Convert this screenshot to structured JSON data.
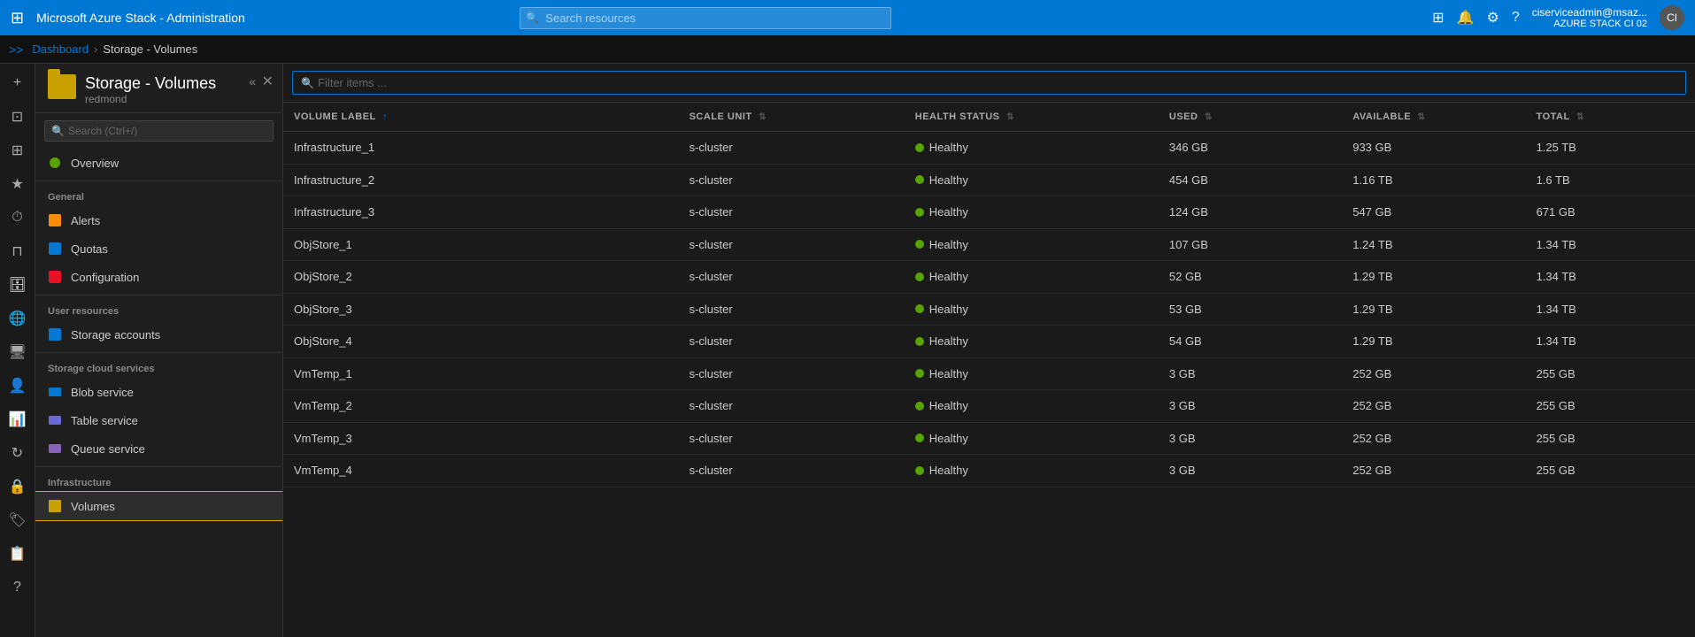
{
  "app": {
    "title": "Microsoft Azure Stack - Administration"
  },
  "topbar": {
    "title": "Microsoft Azure Stack - Administration",
    "search_placeholder": "Search resources",
    "user_name": "ciserviceadmin@msaz...",
    "user_subtitle": "AZURE STACK CI 02",
    "user_initials": "CI"
  },
  "breadcrumb": {
    "expand_label": ">>",
    "items": [
      "Dashboard",
      "Storage - Volumes"
    ]
  },
  "panel": {
    "title": "Storage - Volumes",
    "subtitle": "redmond",
    "icon": "📁",
    "search_placeholder": "Search (Ctrl+/)"
  },
  "nav": {
    "overview_label": "Overview",
    "general_label": "General",
    "general_items": [
      {
        "label": "Alerts",
        "icon": "alerts"
      },
      {
        "label": "Quotas",
        "icon": "quotas"
      },
      {
        "label": "Configuration",
        "icon": "config"
      }
    ],
    "user_resources_label": "User resources",
    "user_items": [
      {
        "label": "Storage accounts",
        "icon": "storage"
      }
    ],
    "storage_cloud_label": "Storage cloud services",
    "cloud_items": [
      {
        "label": "Blob service",
        "icon": "blob"
      },
      {
        "label": "Table service",
        "icon": "table"
      },
      {
        "label": "Queue service",
        "icon": "queue"
      }
    ],
    "infrastructure_label": "Infrastructure",
    "infra_items": [
      {
        "label": "Volumes",
        "icon": "volume",
        "active": true
      }
    ]
  },
  "filter": {
    "placeholder": "Filter items ..."
  },
  "table": {
    "columns": [
      {
        "label": "VOLUME LABEL",
        "key": "volume_label",
        "sortable": true,
        "sorted": true
      },
      {
        "label": "SCALE UNIT",
        "key": "scale_unit",
        "sortable": true
      },
      {
        "label": "HEALTH STATUS",
        "key": "health_status",
        "sortable": true
      },
      {
        "label": "USED",
        "key": "used",
        "sortable": true
      },
      {
        "label": "AVAILABLE",
        "key": "available",
        "sortable": true
      },
      {
        "label": "TOTAL",
        "key": "total",
        "sortable": true
      }
    ],
    "rows": [
      {
        "volume_label": "Infrastructure_1",
        "scale_unit": "s-cluster",
        "health_status": "Healthy",
        "used": "346 GB",
        "available": "933 GB",
        "total": "1.25 TB"
      },
      {
        "volume_label": "Infrastructure_2",
        "scale_unit": "s-cluster",
        "health_status": "Healthy",
        "used": "454 GB",
        "available": "1.16 TB",
        "total": "1.6 TB"
      },
      {
        "volume_label": "Infrastructure_3",
        "scale_unit": "s-cluster",
        "health_status": "Healthy",
        "used": "124 GB",
        "available": "547 GB",
        "total": "671 GB"
      },
      {
        "volume_label": "ObjStore_1",
        "scale_unit": "s-cluster",
        "health_status": "Healthy",
        "used": "107 GB",
        "available": "1.24 TB",
        "total": "1.34 TB"
      },
      {
        "volume_label": "ObjStore_2",
        "scale_unit": "s-cluster",
        "health_status": "Healthy",
        "used": "52 GB",
        "available": "1.29 TB",
        "total": "1.34 TB"
      },
      {
        "volume_label": "ObjStore_3",
        "scale_unit": "s-cluster",
        "health_status": "Healthy",
        "used": "53 GB",
        "available": "1.29 TB",
        "total": "1.34 TB"
      },
      {
        "volume_label": "ObjStore_4",
        "scale_unit": "s-cluster",
        "health_status": "Healthy",
        "used": "54 GB",
        "available": "1.29 TB",
        "total": "1.34 TB"
      },
      {
        "volume_label": "VmTemp_1",
        "scale_unit": "s-cluster",
        "health_status": "Healthy",
        "used": "3 GB",
        "available": "252 GB",
        "total": "255 GB"
      },
      {
        "volume_label": "VmTemp_2",
        "scale_unit": "s-cluster",
        "health_status": "Healthy",
        "used": "3 GB",
        "available": "252 GB",
        "total": "255 GB"
      },
      {
        "volume_label": "VmTemp_3",
        "scale_unit": "s-cluster",
        "health_status": "Healthy",
        "used": "3 GB",
        "available": "252 GB",
        "total": "255 GB"
      },
      {
        "volume_label": "VmTemp_4",
        "scale_unit": "s-cluster",
        "health_status": "Healthy",
        "used": "3 GB",
        "available": "252 GB",
        "total": "255 GB"
      }
    ]
  },
  "icons": {
    "portal": "⊞",
    "bell": "🔔",
    "gear": "⚙",
    "question": "?",
    "search": "🔍",
    "plus": "+",
    "dashboard": "⊡",
    "favorites": "★",
    "allservices": "⊞",
    "recent": "⏱",
    "resource_groups": "⊓",
    "users": "👤",
    "help": "?",
    "feedback": "☺",
    "settings": "⚙",
    "sort_up": "↑",
    "sort_both": "⇅",
    "collapse": "«",
    "close": "✕"
  }
}
